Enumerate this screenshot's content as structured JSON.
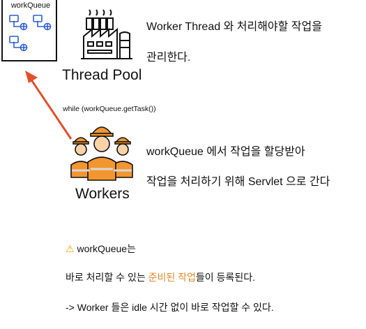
{
  "queue_box": {
    "title": "workQueue"
  },
  "thread_pool": {
    "label": "Thread Pool",
    "description_line1": "Worker Thread 와 처리해야할 작업을",
    "description_line2": "관리한다."
  },
  "loop_code": "while (workQueue.getTask())",
  "workers": {
    "label": "Workers",
    "description_line1": "workQueue 에서 작업을 할당받아",
    "description_line2": "작업을 처리하기 위해 Servlet 으로 간다"
  },
  "note": {
    "warning_icon": "⚠",
    "heading": "workQueue는",
    "line1_prefix": "바로 처리할 수 있는 ",
    "line1_highlight": "준비된 작업",
    "line1_suffix": "들이 등록된다.",
    "line2": "-> Worker 들은 idle 시간 없이 바로 작업할 수 있다."
  },
  "colors": {
    "arrow": "#e0502e",
    "queue_icon": "#2f5fd0",
    "worker_orange": "#f3962f",
    "highlight": "#e58a2a"
  }
}
